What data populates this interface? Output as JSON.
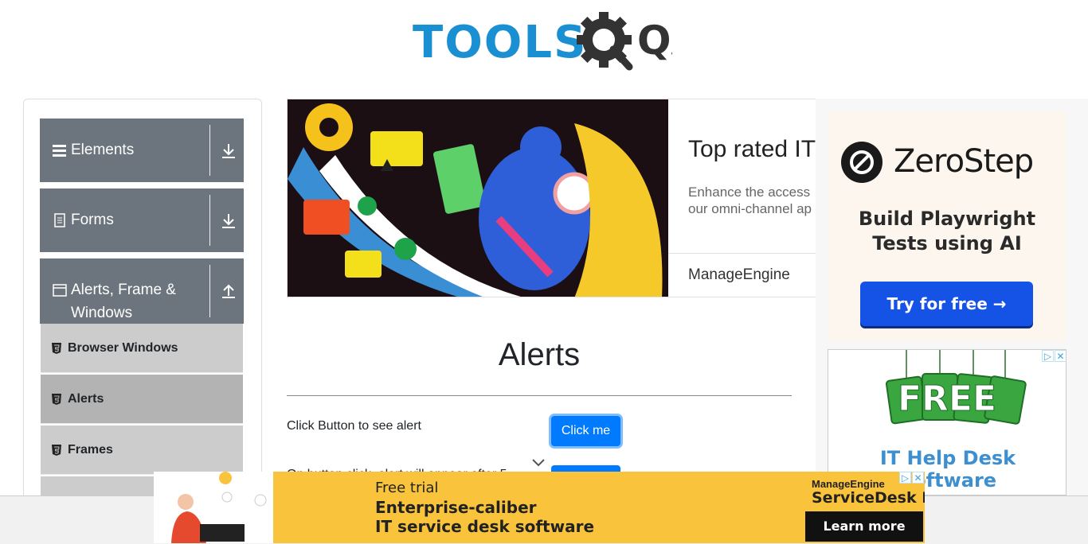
{
  "logo": {
    "text_tools": "TOOLS",
    "text_qa": "QA"
  },
  "sidebar": {
    "groups": [
      {
        "label": "Elements",
        "icon": "hamburger-icon",
        "arrow": "download-arrow-icon"
      },
      {
        "label": "Forms",
        "icon": "form-icon",
        "arrow": "download-arrow-icon"
      },
      {
        "label": "Alerts, Frame & Windows",
        "label_line1": "Alerts, Frame &",
        "label_line2": "Windows",
        "icon": "window-icon",
        "arrow": "upload-arrow-icon"
      }
    ],
    "items": [
      {
        "label": "Browser Windows"
      },
      {
        "label": "Alerts",
        "active": true
      },
      {
        "label": "Frames"
      }
    ],
    "group_color": "#6c757d"
  },
  "banner": {
    "title": "Top rated IT",
    "desc_line1": "Enhance the access",
    "desc_line2": "our omni-channel ap",
    "brand": "ManageEngine"
  },
  "main": {
    "title": "Alerts",
    "rows": [
      {
        "label": "Click Button to see alert",
        "button": "Click me"
      },
      {
        "label": "On button click, alert will appear after 5"
      }
    ],
    "accent": "#007bff"
  },
  "ads": {
    "zerostep": {
      "name": "ZeroStep",
      "tag_line1": "Build Playwright",
      "tag_line2": "Tests using AI",
      "cta": "Try for free →"
    },
    "free": {
      "badge": "FREE",
      "text": "IT Help Desk Software"
    },
    "bottom": {
      "free_trial": "Free trial",
      "line1": "Enterprise-caliber",
      "line2": "IT service desk software",
      "brand_small": "ManageEngine",
      "product": "ServiceDesk Plus",
      "cta": "Learn more"
    }
  }
}
